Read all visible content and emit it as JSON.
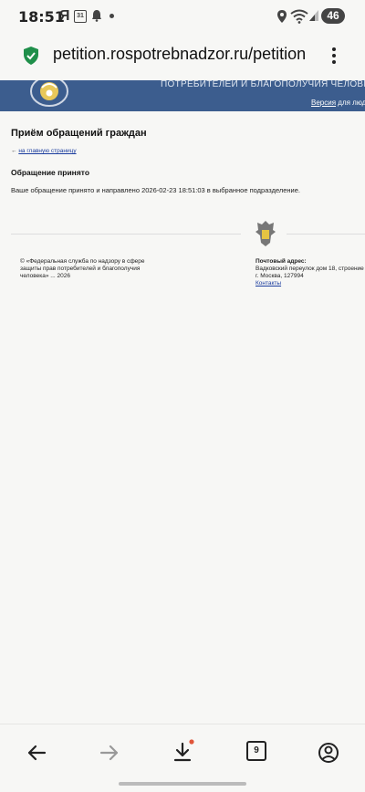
{
  "status_bar": {
    "time": "18:51",
    "app_letter": "Я",
    "calendar_badge": "31",
    "battery": "46"
  },
  "browser": {
    "url": "petition.rospotrebnadzor.ru/petition",
    "tabs_count": "9"
  },
  "banner": {
    "org_name": "ПОТРЕБИТЕЛЕЙ И БЛАГОПОЛУЧИЯ ЧЕЛОВЕКА",
    "version_link": "Версия",
    "version_suffix": " для люде"
  },
  "page": {
    "title": "Приём обращений граждан",
    "back_arrow": "←",
    "back_link": "на главную страницу",
    "section_title": "Обращение принято",
    "message": "Ваше обращение принято и направлено 2026-02-23 18:51:03 в выбранное подразделение."
  },
  "footer": {
    "copyright": "© «Федеральная служба по надзору в сфере защиты прав потребителей и благополучия человека» ... 2026",
    "address_label": "Почтовый адрес:",
    "address_line1": "Вадковский переулок дом 18, строение",
    "address_line2": "г. Москва, 127994",
    "contacts_link": "Контакты"
  },
  "colors": {
    "banner": "#3c5d8e",
    "link": "#1a3c9e",
    "shield": "#1f8f4a"
  }
}
